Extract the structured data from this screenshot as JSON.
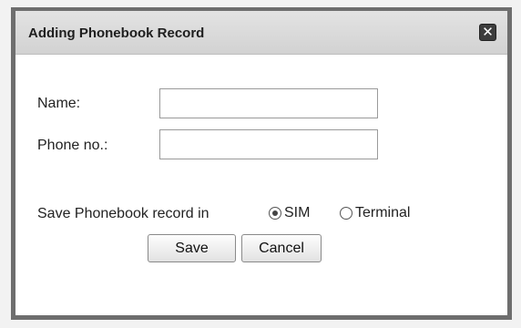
{
  "dialog": {
    "title": "Adding Phonebook Record",
    "close_glyph": "✕"
  },
  "form": {
    "name_label": "Name:",
    "name_value": "",
    "phone_label": "Phone no.:",
    "phone_value": "",
    "save_in_label": "Save Phonebook record in",
    "options": [
      {
        "label": "SIM",
        "selected": true
      },
      {
        "label": "Terminal",
        "selected": false
      }
    ]
  },
  "buttons": {
    "save_label": "Save",
    "cancel_label": "Cancel"
  }
}
